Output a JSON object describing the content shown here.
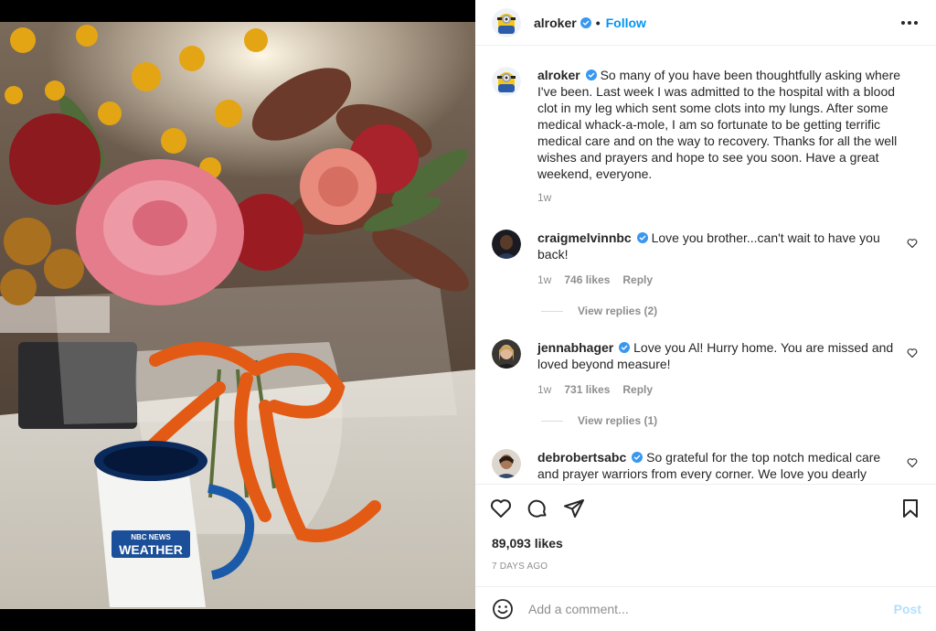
{
  "post": {
    "author": "alroker",
    "follow_label": "Follow",
    "separator": "•",
    "caption": "So many of you have been thoughtfully asking where I've been. Last week I was admitted to the hospital with a blood clot in my leg which sent some clots into my lungs. After some medical whack-a-mole, I am so fortunate to be getting terrific medical care and on the way to recovery. Thanks for all the well wishes and prayers and hope to see you soon. Have a great weekend, everyone.",
    "caption_time": "1w",
    "likes": "89,093 likes",
    "posted_ago": "7 DAYS AGO",
    "mug_text_top": "NBC NEWS",
    "mug_text_bottom": "WEATHER"
  },
  "comments": [
    {
      "user": "craigmelvinnbc",
      "text": "Love you brother...can't wait to have you back!",
      "time": "1w",
      "likes": "746 likes",
      "reply_label": "Reply",
      "view_replies": "View replies (2)"
    },
    {
      "user": "jennabhager",
      "text": "Love you Al! Hurry home. You are missed and loved beyond measure!",
      "time": "1w",
      "likes": "731 likes",
      "reply_label": "Reply",
      "view_replies": "View replies (1)"
    },
    {
      "user": "debrobertsabc",
      "text": "So grateful for the top notch medical care and prayer warriors from every corner. We love you dearly"
    }
  ],
  "composer": {
    "placeholder": "Add a comment...",
    "post_label": "Post"
  },
  "icons": {
    "verified": "verified-badge-icon",
    "more": "more-options-icon",
    "like": "heart-icon",
    "comment": "comment-bubble-icon",
    "share": "paper-plane-icon",
    "save": "bookmark-icon",
    "emoji": "emoji-icon"
  },
  "colors": {
    "accent": "#0095f6",
    "verified": "#3897f0",
    "muted": "#8e8e8e",
    "post_disabled": "#b2dffc"
  }
}
